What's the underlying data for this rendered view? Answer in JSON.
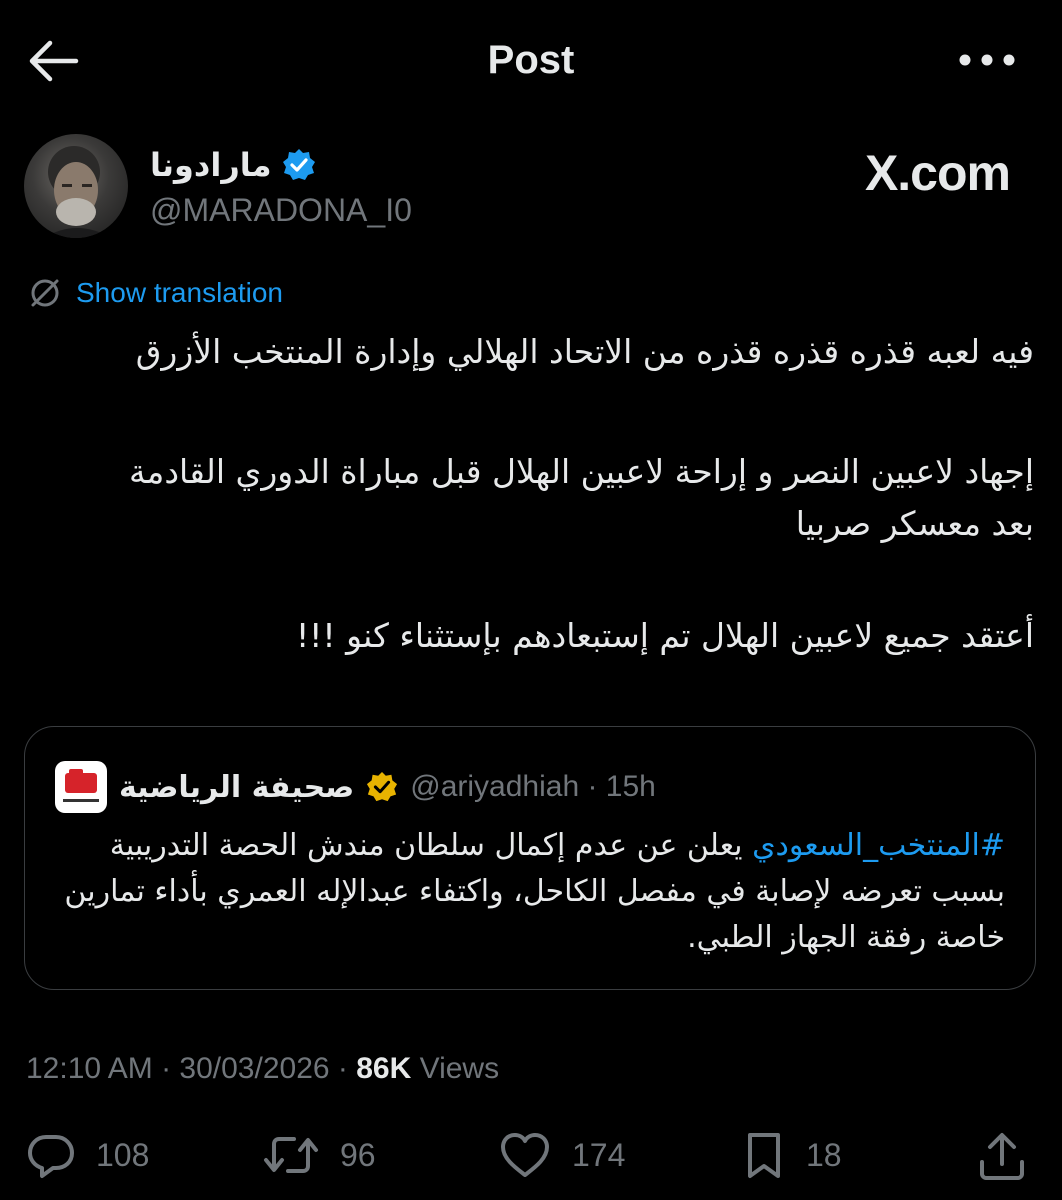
{
  "header": {
    "title": "Post",
    "back_icon": "arrow-left-icon",
    "more_icon": "more-horizontal-icon"
  },
  "author": {
    "display_name": "مارادونا",
    "handle": "@MARADONA_I0",
    "verified_color": "#1d9bf0"
  },
  "watermark": "X.com",
  "translation": {
    "label": "Show translation",
    "icon": "globe-slash-icon"
  },
  "tweet": {
    "line1": "فيه لعبه قذره قذره قذره من الاتحاد الهلالي وإدارة المنتخب الأزرق",
    "line2": "إجهاد لاعبين النصر و إراحة لاعبين الهلال قبل مباراة الدوري القادمة",
    "line3": "بعد معسكر صربيا",
    "line4": "أعتقد جميع لاعبين الهلال تم إستبعادهم بإستثناء كنو !!!"
  },
  "quote": {
    "name": "صحيفة الرياضية",
    "handle": "@ariyadhiah · 15h",
    "verified_color": "#e8b300",
    "hashtag": "#المنتخب_السعودي",
    "text": " يعلن عن عدم إكمال سلطان مندش الحصة التدريبية بسبب تعرضه لإصابة في مفصل الكاحل، واكتفاء عبدالإله العمري بأداء تمارين خاصة رفقة الجهاز الطبي."
  },
  "meta": {
    "time_date": "12:10 AM · 30/03/2026 · ",
    "views_count": "86K",
    "views_label": " Views"
  },
  "actions": {
    "replies": "108",
    "reposts": "96",
    "likes": "174",
    "bookmarks": "18"
  },
  "colors": {
    "background": "#000000",
    "text": "#e7e9ea",
    "muted": "#71767b",
    "accent": "#1d9bf0"
  }
}
